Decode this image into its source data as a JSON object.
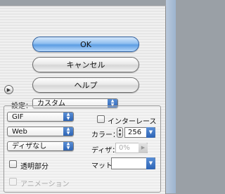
{
  "buttons": {
    "ok": "OK",
    "cancel": "キャンセル",
    "help": "ヘルプ"
  },
  "settings": {
    "label": "設定：",
    "value": "カスタム"
  },
  "format": {
    "value": "GIF"
  },
  "interlace": {
    "label": "インターレース",
    "checked": false
  },
  "palette": {
    "value": "Web"
  },
  "colors": {
    "label": "カラー：",
    "value": "256"
  },
  "dither_algorithm": {
    "value": "ディザなし"
  },
  "dither": {
    "label": "ディザ：",
    "value": "0%",
    "enabled": false
  },
  "transparency": {
    "label": "透明部分",
    "checked": false
  },
  "matte": {
    "label": "マット：",
    "value": ""
  },
  "animation": {
    "label": "アニメーション",
    "checked": false,
    "enabled": false
  },
  "icons": {
    "disclosure": "disclosure-triangle-icon",
    "popup_arrows": "up-down-arrows-icon",
    "dropdown": "chevron-down-icon",
    "flyout": "triangle-right-icon"
  },
  "colors_theme": {
    "default_button": "#5c9de3",
    "popup_arrow": "#2d64b5"
  }
}
